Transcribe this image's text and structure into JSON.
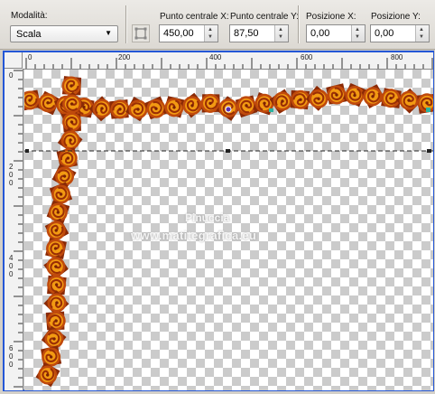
{
  "toolbar": {
    "mode_label": "Modalità:",
    "mode_value": "Scala",
    "center_x_label": "Punto centrale X:",
    "center_x_value": "450,00",
    "center_y_label": "Punto centrale Y:",
    "center_y_value": "87,50",
    "pos_x_label": "Posizione X:",
    "pos_x_value": "0,00",
    "pos_y_label": "Posizione Y:",
    "pos_y_value": "0,00"
  },
  "ruler": {
    "h_ticks": [
      "0",
      "200",
      "400",
      "600",
      "800"
    ],
    "v_ticks": [
      "0",
      "2",
      "0",
      "0",
      "4",
      "0",
      "0",
      "6",
      "0",
      "0"
    ]
  },
  "watermark": {
    "line1": "Pinuccia",
    "line2": "www.matitegrafica.eu"
  },
  "colors": {
    "window_border": "#2457d6",
    "chain_outer": "#b8400a",
    "chain_inner": "#f29a12"
  },
  "icons": [
    "pick-tool-icon",
    "chevron-down-icon",
    "spin-up-icon",
    "spin-down-icon"
  ]
}
